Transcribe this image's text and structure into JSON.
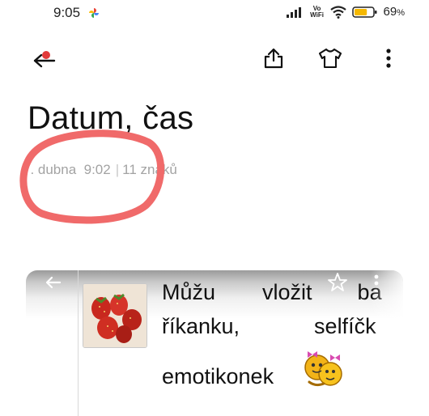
{
  "status_bar": {
    "time": "9:05",
    "volte_top": "Vo",
    "volte_bottom": "WiFi",
    "battery_percent": "69",
    "battery_unit": "%",
    "battery_level": 0.69,
    "battery_color": "#f5b800"
  },
  "toolbar": {
    "back_icon": "back-arrow-icon",
    "share_icon": "share-icon",
    "theme_icon": "shirt-icon",
    "more_icon": "more-vertical-icon"
  },
  "note": {
    "title": "Datum, čas",
    "date": "7. dubna  9:02",
    "char_count": "11 znaků"
  },
  "annotation_color": "#f06a6a",
  "card": {
    "line1": [
      "Můžu",
      "vložit",
      "ba"
    ],
    "line2": [
      "říkanku,",
      "selfíčk"
    ],
    "line3": "emotikonek"
  }
}
